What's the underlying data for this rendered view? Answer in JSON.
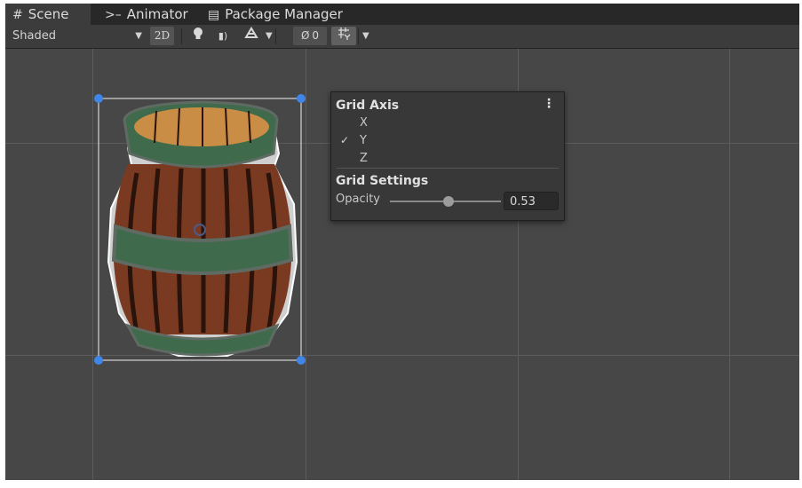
{
  "tabs": [
    {
      "icon": "grid-icon",
      "label": "Scene",
      "active": true
    },
    {
      "icon": "animator-icon",
      "label": "Animator",
      "active": false
    },
    {
      "icon": "package-icon",
      "label": "Package Manager",
      "active": false
    }
  ],
  "toolbar": {
    "shading_mode": "Shaded",
    "mode_2d": "2D",
    "hidden_count": "0"
  },
  "popup": {
    "title": "Grid Axis",
    "axis_options": [
      {
        "label": "X",
        "checked": false
      },
      {
        "label": "Y",
        "checked": true
      },
      {
        "label": "Z",
        "checked": false
      }
    ],
    "check_mark": "✓",
    "settings_title": "Grid Settings",
    "opacity_label": "Opacity",
    "opacity_value": "0.53",
    "opacity_fraction": 0.53
  },
  "colors": {
    "panel_bg": "#474747",
    "tab_bar": "#282828",
    "toolbar": "#3c3c3c",
    "gizmo_handle": "#3f86e8",
    "barrel_wood": "#7a3a22",
    "barrel_band": "#3f6a4c",
    "barrel_top": "#c98d45"
  }
}
